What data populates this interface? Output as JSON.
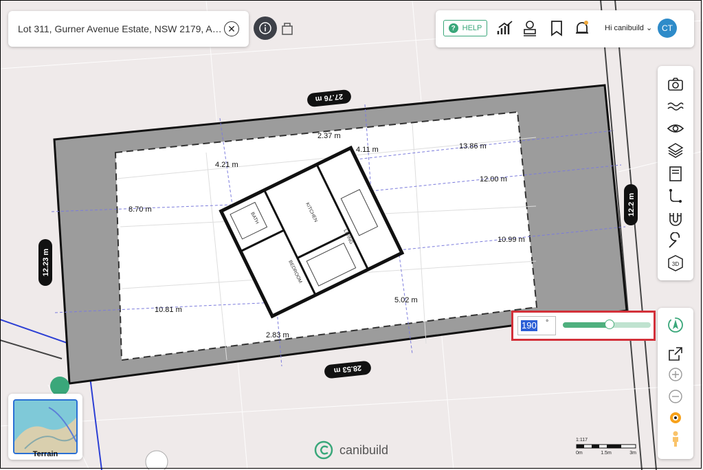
{
  "search": {
    "address": "Lot 311, Gurner Avenue Estate, NSW 2179, Austr…",
    "clear_icon": "close-icon"
  },
  "info_icon": "info-icon",
  "basket_icon": "basket-icon",
  "topbar": {
    "help_label": "HELP",
    "help_icon": "question-icon",
    "user_label": "Hi canibuild",
    "avatar_initials": "CT",
    "avatar_color": "#2e8bc9"
  },
  "tools": [
    "camera-icon",
    "water-icon",
    "eye-icon",
    "layers-icon",
    "document-icon",
    "path-icon",
    "magnet-icon",
    "wrench-icon",
    "3d-icon"
  ],
  "tools2": [
    "compass-rotate-icon",
    "share-icon",
    "zoom-in-icon",
    "zoom-out-icon",
    "street-view-eye-icon",
    "person-icon"
  ],
  "rotation": {
    "value": "190",
    "unit": "°",
    "slider_fraction": 0.53
  },
  "dimensions": {
    "top_boundary": "27.76 m",
    "bottom_boundary": "28.53 m",
    "left_boundary": "12.23 m",
    "right_boundary": "12.2 m",
    "m_237": "2.37 m",
    "m_411": "4.11 m",
    "m_1386": "13.86 m",
    "m_421": "4.21 m",
    "m_1200": "12.00 m",
    "m_870": "8.70 m",
    "m_1099": "10.99 m",
    "m_502": "5.02 m",
    "m_1081": "10.81 m",
    "m_283": "2.83 m"
  },
  "rooms": {
    "kitchen": "KITCHEN",
    "living": "LIVING",
    "bath": "BATH",
    "bedroom": "BEDROOM"
  },
  "terrain_label": "Terrain",
  "brand": "canibuild",
  "scale": {
    "ratio": "1:117",
    "t0": "0m",
    "t1": "1.5m",
    "t2": "3m"
  },
  "colors": {
    "accent": "#3aa77a",
    "highlight": "#d3313a",
    "lot_fill": "#9c9c9c"
  }
}
